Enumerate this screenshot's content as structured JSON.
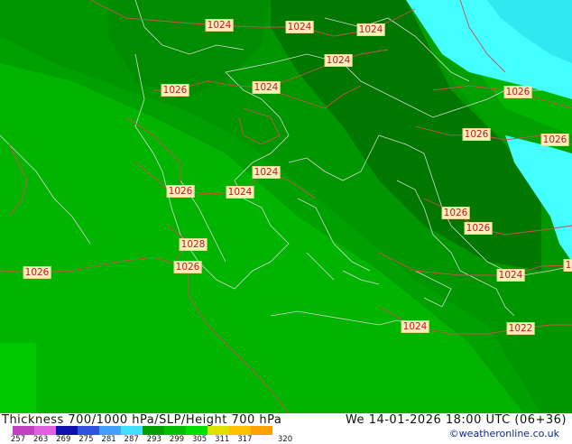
{
  "map": {
    "isobar_labels": [
      "1024",
      "1024",
      "1024",
      "1024",
      "1026",
      "1024",
      "1026",
      "1026",
      "1026",
      "1024",
      "1026",
      "1024",
      "1026",
      "1026",
      "1028",
      "1026",
      "1026",
      "1024",
      "1024",
      "1022",
      "1"
    ]
  },
  "footer": {
    "title": "Thickness 700/1000 hPa/SLP/Height 700 hPa",
    "valid_time": "We 14-01-2026 18:00 UTC (06+36)",
    "copyright": "©weatheronline.co.uk",
    "scale_ticks": [
      "257",
      "263",
      "269",
      "275",
      "281",
      "287",
      "293",
      "299",
      "305",
      "311",
      "317",
      "320"
    ],
    "scale_colors": [
      "#c040c0",
      "#e060e0",
      "#1010b0",
      "#3050e0",
      "#40a0ff",
      "#40e0ff",
      "#00a000",
      "#00c000",
      "#00e000",
      "#e0e000",
      "#ffc000",
      "#ffa000"
    ]
  },
  "colors": {
    "green_darkest": "#007800",
    "green_dark": "#009600",
    "green_mid": "#00aa00",
    "green_light": "#00c000",
    "cyan": "#44ffff",
    "isobar": "#c85050"
  }
}
